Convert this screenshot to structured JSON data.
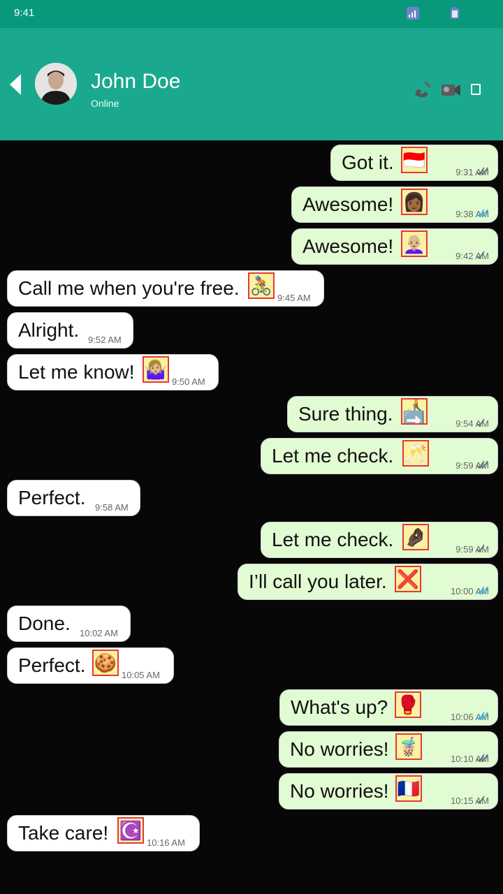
{
  "status_bar": {
    "time": "9:41"
  },
  "header": {
    "name": "John Doe",
    "status": "Online",
    "icons": [
      "back-arrow-icon",
      "call-icon",
      "video-icon",
      "menu-icon"
    ]
  },
  "colors": {
    "status_bar": "#08997b",
    "header": "#1aa98e",
    "incoming": "#ffffff",
    "outgoing": "#e1fbd2",
    "read_tick": "#34b7f1",
    "sent_tick": "#5a6b7a"
  },
  "messages": [
    {
      "dir": "out",
      "text": "Got it.",
      "emoji": "🇮🇩",
      "time": "9:31 AM",
      "ticks": "double"
    },
    {
      "dir": "out",
      "text": "Awesome!",
      "emoji": "👩🏾",
      "time": "9:38 AM",
      "ticks": "double-read"
    },
    {
      "dir": "out",
      "text": "Awesome!",
      "emoji": "👩🏼‍🦲",
      "time": "9:42 AM",
      "ticks": "single"
    },
    {
      "dir": "in",
      "text": "Call me when you're free.",
      "emoji": "🚴🏽",
      "time": "9:45 AM"
    },
    {
      "dir": "in",
      "text": "Alright.",
      "emoji": "",
      "time": "9:52 AM"
    },
    {
      "dir": "in",
      "text": "Let me know!",
      "emoji": "🤷🏼‍♀️",
      "time": "9:50 AM"
    },
    {
      "dir": "out",
      "text": "Sure thing.",
      "emoji": "🧑‍🦯➡️",
      "time": "9:54 AM",
      "ticks": "single"
    },
    {
      "dir": "out",
      "text": "Let me check.",
      "emoji": "🥂",
      "time": "9:59 AM",
      "ticks": "double"
    },
    {
      "dir": "in",
      "text": "Perfect.",
      "emoji": "",
      "time": "9:58 AM"
    },
    {
      "dir": "out",
      "text": "Let me check.",
      "emoji": "🤌🏿",
      "time": "9:59 AM",
      "ticks": "single"
    },
    {
      "dir": "out",
      "text": "I’ll call you later.",
      "emoji": "❌",
      "time": "10:00 AM",
      "ticks": "double-read"
    },
    {
      "dir": "in",
      "text": "Done.",
      "emoji": "",
      "time": "10:02 AM"
    },
    {
      "dir": "in",
      "text": "Perfect.",
      "emoji": "🍪",
      "time": "10:05 AM"
    },
    {
      "dir": "out",
      "text": "What's up?",
      "emoji": "🥊",
      "time": "10:06 AM",
      "ticks": "double-read"
    },
    {
      "dir": "out",
      "text": "No worries!",
      "emoji": "🧋",
      "time": "10:10 AM",
      "ticks": "double"
    },
    {
      "dir": "out",
      "text": "No worries!",
      "emoji": "🇫🇷",
      "time": "10:15 AM",
      "ticks": "single"
    },
    {
      "dir": "in",
      "text": "Take care!",
      "emoji": "☪️",
      "time": "10:16 AM"
    }
  ]
}
